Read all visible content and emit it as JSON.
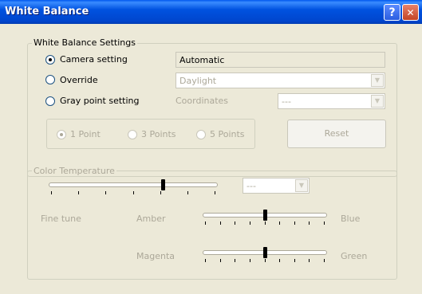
{
  "window": {
    "title": "White Balance",
    "help_glyph": "?",
    "close_glyph": "✕"
  },
  "wb_group": {
    "legend": "White Balance Settings",
    "camera": {
      "label": "Camera setting",
      "value": "Automatic",
      "selected": true
    },
    "override": {
      "label": "Override",
      "value": "Daylight",
      "selected": false
    },
    "gray": {
      "label": "Gray point setting",
      "coords_label": "Coordinates",
      "coords_value": "---",
      "selected": false
    },
    "points": [
      {
        "label": "1 Point",
        "selected": true
      },
      {
        "label": "3 Points",
        "selected": false
      },
      {
        "label": "5 Points",
        "selected": false
      }
    ],
    "reset_label": "Reset"
  },
  "ct_group": {
    "legend": "Color Temperature",
    "dropdown_value": "---",
    "fine_tune_label": "Fine tune",
    "amber_label": "Amber",
    "blue_label": "Blue",
    "magenta_label": "Magenta",
    "green_label": "Green",
    "temp_slider_level": 0.68,
    "amber_blue_level": 0.5,
    "magenta_green_level": 0.5
  },
  "colors": {
    "title_bar": "#0054e3",
    "dialog_bg": "#ece9d8",
    "disabled_text": "#aca899"
  },
  "icons": {
    "help": "help-icon",
    "close": "close-icon",
    "combo_arrow": "chevron-down-icon"
  }
}
